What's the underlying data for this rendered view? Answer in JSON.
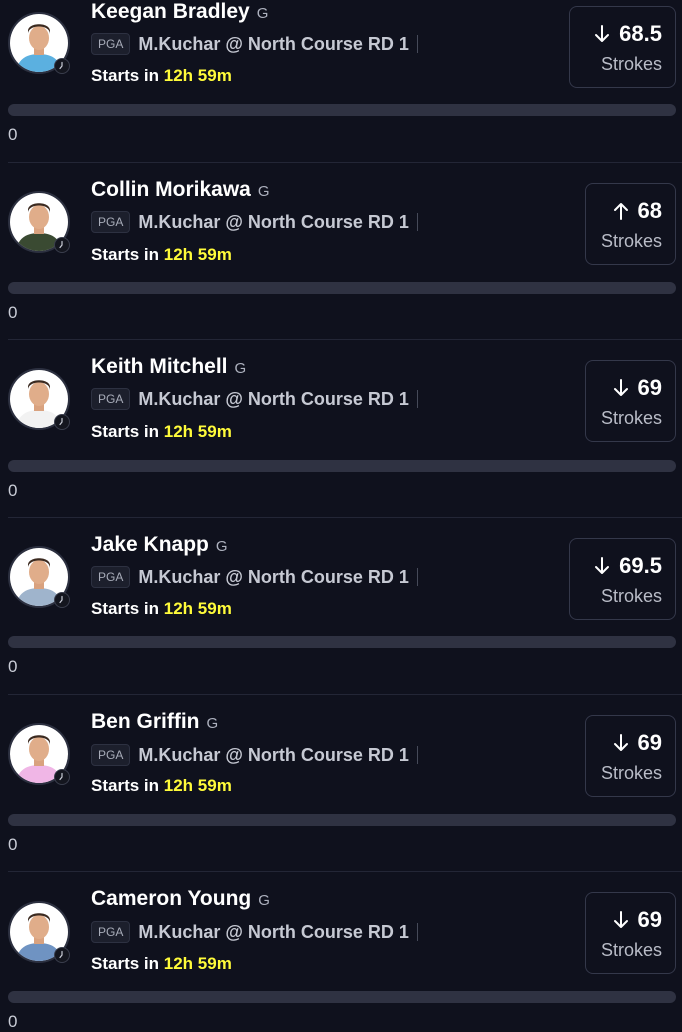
{
  "players": [
    {
      "name": "Keegan Bradley",
      "position": "G",
      "league": "PGA",
      "matchup": "M.Kuchar @ North Course RD 1",
      "starts_prefix": "Starts in",
      "countdown": "12h 59m",
      "direction": "down",
      "line": "68.5",
      "unit": "Strokes",
      "progress_value": "0",
      "progress_fraction": 0,
      "shirt_color": "#5bb0e0"
    },
    {
      "name": "Collin Morikawa",
      "position": "G",
      "league": "PGA",
      "matchup": "M.Kuchar @ North Course RD 1",
      "starts_prefix": "Starts in",
      "countdown": "12h 59m",
      "direction": "up",
      "line": "68",
      "unit": "Strokes",
      "progress_value": "0",
      "progress_fraction": 0,
      "shirt_color": "#3a4a32"
    },
    {
      "name": "Keith Mitchell",
      "position": "G",
      "league": "PGA",
      "matchup": "M.Kuchar @ North Course RD 1",
      "starts_prefix": "Starts in",
      "countdown": "12h 59m",
      "direction": "down",
      "line": "69",
      "unit": "Strokes",
      "progress_value": "0",
      "progress_fraction": 0,
      "shirt_color": "#f2f2f2"
    },
    {
      "name": "Jake Knapp",
      "position": "G",
      "league": "PGA",
      "matchup": "M.Kuchar @ North Course RD 1",
      "starts_prefix": "Starts in",
      "countdown": "12h 59m",
      "direction": "down",
      "line": "69.5",
      "unit": "Strokes",
      "progress_value": "0",
      "progress_fraction": 0,
      "shirt_color": "#9fb4cc"
    },
    {
      "name": "Ben Griffin",
      "position": "G",
      "league": "PGA",
      "matchup": "M.Kuchar @ North Course RD 1",
      "starts_prefix": "Starts in",
      "countdown": "12h 59m",
      "direction": "down",
      "line": "69",
      "unit": "Strokes",
      "progress_value": "0",
      "progress_fraction": 0,
      "shirt_color": "#f0b6e6"
    },
    {
      "name": "Cameron Young",
      "position": "G",
      "league": "PGA",
      "matchup": "M.Kuchar @ North Course RD 1",
      "starts_prefix": "Starts in",
      "countdown": "12h 59m",
      "direction": "down",
      "line": "69",
      "unit": "Strokes",
      "progress_value": "0",
      "progress_fraction": 0,
      "shirt_color": "#6f93c2"
    }
  ],
  "colors": {
    "background": "#0f111d",
    "countdown": "#fffb3a",
    "progress_track": "#2f3242"
  },
  "icons": {
    "direction_down": "arrow-down-icon",
    "direction_up": "arrow-up-icon",
    "team_badge": "clock-badge-icon"
  }
}
